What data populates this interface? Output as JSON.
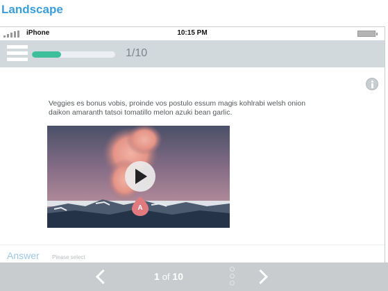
{
  "section_title": "Landscape",
  "statusbar": {
    "carrier": "iPhone",
    "time": "10:15 PM",
    "signal_icon": "signal-bars-icon",
    "battery_icon": "battery-icon"
  },
  "header": {
    "menu_icon": "hamburger-menu-icon",
    "progress_fraction": 0.35,
    "progress_label": "1/10",
    "colors": {
      "progress_fill": "#3cbf9a",
      "header_bg": "#d2d9dd"
    }
  },
  "question": {
    "text": "Veggies es bonus vobis, proinde vos postulo essum magis kohlrabi welsh onion daikon amaranth tatsoi tomatillo melon azuki bean garlic.",
    "info_icon": "info-icon",
    "media_icon": "play-icon",
    "hotspot_label": "A"
  },
  "answer": {
    "label": "Answer",
    "hint": "Please select"
  },
  "footer": {
    "current_page": "1",
    "of_label": "of",
    "total_pages": "10",
    "prev_icon": "chevron-left-icon",
    "next_icon": "chevron-right-icon",
    "dots_icon": "page-dots-icon"
  },
  "colors": {
    "accent": "#3a9fd9",
    "answer_label": "#9ec6e6",
    "footer_bg": "#c9ccce"
  }
}
